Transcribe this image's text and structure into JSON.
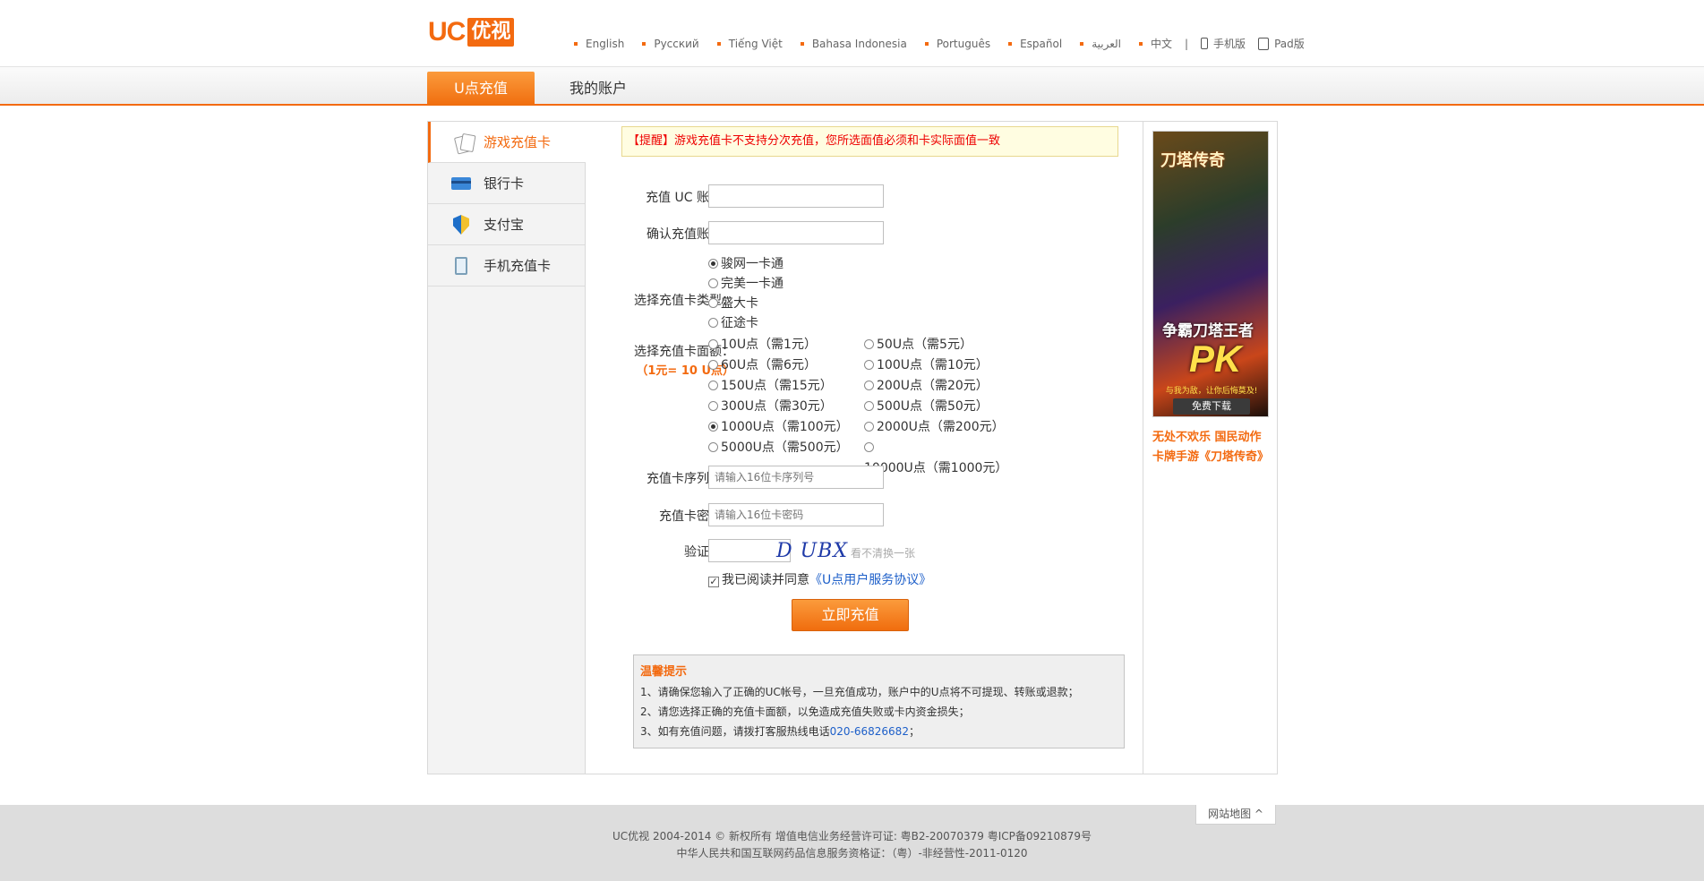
{
  "header": {
    "logo_uc": "UC",
    "logo_yk": "优视",
    "languages": [
      "English",
      "Русский",
      "Tiếng Việt",
      "Bahasa Indonesia",
      "Português",
      "Español",
      "العربية",
      "中文"
    ],
    "separator": "|",
    "mobile_label": "手机版",
    "pad_label": "Pad版"
  },
  "nav": {
    "active_tab": "U点充值",
    "other_tab": "我的账户"
  },
  "sidebar": {
    "items": [
      {
        "label": "游戏充值卡",
        "icon": "cards-icon",
        "active": true
      },
      {
        "label": "银行卡",
        "icon": "bank-card-icon",
        "active": false
      },
      {
        "label": "支付宝",
        "icon": "alipay-shield-icon",
        "active": false
      },
      {
        "label": "手机充值卡",
        "icon": "phone-card-icon",
        "active": false
      }
    ]
  },
  "form": {
    "notice_tag": "【提醒】",
    "notice_text": "游戏充值卡不支持分次充值，您所选面值必须和卡实际面值一致",
    "account_label": "充值 UC 账号：",
    "account_value": "",
    "confirm_label": "确认充值账号：",
    "confirm_value": "",
    "type_label": "选择充值卡类型：",
    "types": [
      {
        "label": "骏网一卡通",
        "selected": true
      },
      {
        "label": "完美一卡通",
        "selected": false
      },
      {
        "label": "盛大卡",
        "selected": false
      },
      {
        "label": "征途卡",
        "selected": false
      }
    ],
    "denom_label": "选择充值卡面额：",
    "denom_rate": "（1元= 10 U点）",
    "denominations": [
      {
        "label": "10U点（需1元）",
        "selected": false
      },
      {
        "label": "50U点（需5元）",
        "selected": false
      },
      {
        "label": "60U点（需6元）",
        "selected": false
      },
      {
        "label": "100U点（需10元）",
        "selected": false
      },
      {
        "label": "150U点（需15元）",
        "selected": false
      },
      {
        "label": "200U点（需20元）",
        "selected": false
      },
      {
        "label": "300U点（需30元）",
        "selected": false
      },
      {
        "label": "500U点（需50元）",
        "selected": false
      },
      {
        "label": "1000U点（需100元）",
        "selected": true
      },
      {
        "label": "2000U点（需200元）",
        "selected": false
      },
      {
        "label": "5000U点（需500元）",
        "selected": false
      },
      {
        "label": "10000U点（需1000元）",
        "selected": false
      }
    ],
    "serial_label": "充值卡序列号：",
    "serial_placeholder": "请输入16位卡序列号",
    "password_label": "充值卡密码：",
    "password_placeholder": "请输入16位卡密码",
    "captcha_label": "验证码：",
    "captcha_text": "D UBX",
    "captcha_refresh": "看不清换一张",
    "agree_text": "我已阅读并同意",
    "agree_link": "《U点用户服务协议》",
    "agree_checked": true,
    "submit_label": "立即充值"
  },
  "tips": {
    "title": "温馨提示",
    "line1": "1、请确保您输入了正确的UC帐号，一旦充值成功，账户中的U点将不可提现、转账或退款；",
    "line2": "2、请您选择正确的充值卡面额，以免造成充值失败或卡内资金损失；",
    "line3_prefix": "3、如有充值问题，请拨打客服热线电话",
    "hotline": "020-66826682",
    "line3_suffix": "；"
  },
  "ad": {
    "title": "刀塔传奇",
    "slogan": "争霸刀塔王者",
    "pk": "PK",
    "sub": "与我为敌，让你后悔莫及!",
    "download": "免费下载",
    "caption": "无处不欢乐 国民动作卡牌手游《刀塔传奇》"
  },
  "footer": {
    "sitemap": "网站地图 ^",
    "line1": "UC优视 2004-2014 © 新权所有 增值电信业务经营许可证: 粤B2-20070379 粤ICP备09210879号",
    "line2": "中华人民共和国互联网药品信息服务资格证：（粤）-非经营性-2011-0120"
  },
  "colors": {
    "accent": "#f36a10",
    "link": "#1d5fc9",
    "notice_bg": "#fffde1",
    "notice_text": "#ee0000"
  }
}
